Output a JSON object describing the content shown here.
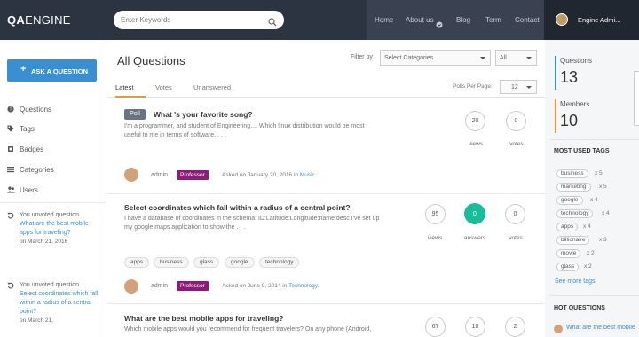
{
  "header": {
    "logo_bold": "QA",
    "logo_rest": "ENGINE",
    "search_placeholder": "Enter Keywords",
    "nav": [
      {
        "label": "Home"
      },
      {
        "label": "About us"
      },
      {
        "label": "Blog"
      },
      {
        "label": "Term"
      },
      {
        "label": "Contact"
      }
    ],
    "user_name": "Engine Admi..."
  },
  "sidebar": {
    "ask_button": "ASK A QUESTION",
    "items": [
      {
        "label": "Questions",
        "icon": "question-circle-icon"
      },
      {
        "label": "Tags",
        "icon": "tag-icon"
      },
      {
        "label": "Badges",
        "icon": "badge-icon"
      },
      {
        "label": "Categories",
        "icon": "list-icon"
      },
      {
        "label": "Users",
        "icon": "users-icon"
      }
    ],
    "activity": [
      {
        "action": "You unvoted question",
        "question": "What are the best mobile apps for traveling?",
        "date_prefix": "on",
        "date": "March 21, 2016"
      },
      {
        "action": "You unvoted question",
        "question": "Select coordinates which fall within a radius of a central point?",
        "date_prefix": "on",
        "date": "March 21,"
      }
    ]
  },
  "main": {
    "title": "All Questions",
    "filter_label": "Filter by",
    "category_select": "Select Categories",
    "all_select": "All",
    "tabs": [
      {
        "label": "Latest"
      },
      {
        "label": "Votes"
      },
      {
        "label": "Unanswered"
      }
    ],
    "per_page_label": "Polls Per Page:",
    "per_page_value": "12",
    "questions": [
      {
        "poll": "Poll",
        "title": "What 's your favorite song?",
        "excerpt": "I'm a programmer, and student of Engineering.... Which linux distribution would be most useful to me in terms of software, . . .",
        "views": "20",
        "views_label": "views",
        "votes": "0",
        "votes_label": "votes",
        "author": "admin",
        "badge": "Professor",
        "asked": "Asked on January 20, 2016 in",
        "category": "Music."
      },
      {
        "title": "Select coordinates which fall within a radius of a central point?",
        "excerpt": "I have a database of coordinates in the schema: ID:Latitude:Longitude:name:desc I've set up my google maps application to show the . . .",
        "views": "95",
        "views_label": "views",
        "answers": "0",
        "answers_label": "answers",
        "votes": "0",
        "votes_label": "votes",
        "tags": [
          "apps",
          "business",
          "glass",
          "google",
          "technology"
        ],
        "author": "admin",
        "badge": "Professor",
        "asked": "Asked on June 9, 2014 in",
        "category": "Technology."
      },
      {
        "title": "What are the best mobile apps for traveling?",
        "excerpt": "Which mobile apps would you recommend for frequent travelers? On any phone (Android,",
        "views": "67",
        "answers": "10",
        "votes": "2"
      }
    ]
  },
  "right": {
    "stats": [
      {
        "label": "Questions",
        "value": "13",
        "color": "#3a8fd3"
      },
      {
        "label": "Members",
        "value": "10",
        "color": "#e79a3a"
      }
    ],
    "tags_heading": "MOST USED TAGS",
    "tags": [
      {
        "name": "business",
        "count": "x 5"
      },
      {
        "name": "marketing",
        "count": "x 5"
      },
      {
        "name": "google",
        "count": "x 4"
      },
      {
        "name": "technology",
        "count": "x 4"
      },
      {
        "name": "apps",
        "count": "x 4"
      },
      {
        "name": "billionaire",
        "count": "x 3"
      },
      {
        "name": "movie",
        "count": "x 2"
      },
      {
        "name": "glass",
        "count": "x 2"
      }
    ],
    "see_more": "See more tags",
    "hot_heading": "HOT QUESTIONS",
    "hot_first": "What are the best mobile"
  }
}
